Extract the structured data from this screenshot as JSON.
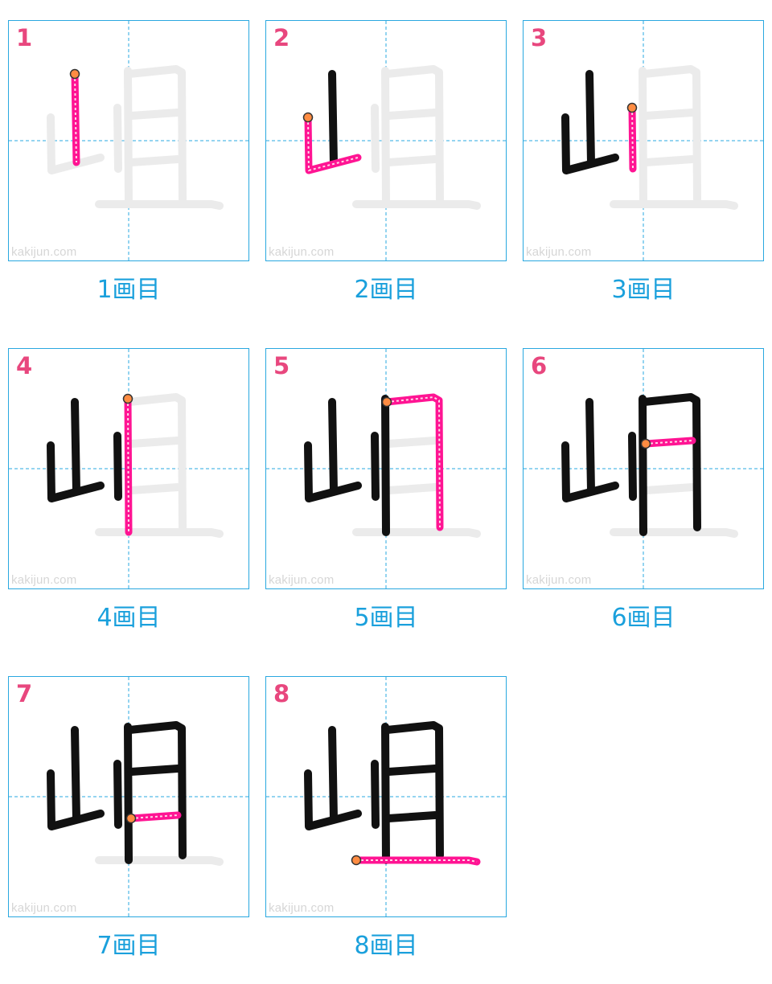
{
  "watermark": "kakijun.com",
  "colors": {
    "guide": "#29a8e0",
    "ghost": "#ebebeb",
    "done": "#111111",
    "current": "#ff1493",
    "dots": "#ffd7e8",
    "start": "#ff8c42",
    "number": "#e8477e",
    "caption": "#1aa0dc"
  },
  "cells": [
    {
      "number": "1",
      "caption": "1画目"
    },
    {
      "number": "2",
      "caption": "2画目"
    },
    {
      "number": "3",
      "caption": "3画目"
    },
    {
      "number": "4",
      "caption": "4画目"
    },
    {
      "number": "5",
      "caption": "5画目"
    },
    {
      "number": "6",
      "caption": "6画目"
    },
    {
      "number": "7",
      "caption": "7画目"
    },
    {
      "number": "8",
      "caption": "8画目"
    }
  ]
}
